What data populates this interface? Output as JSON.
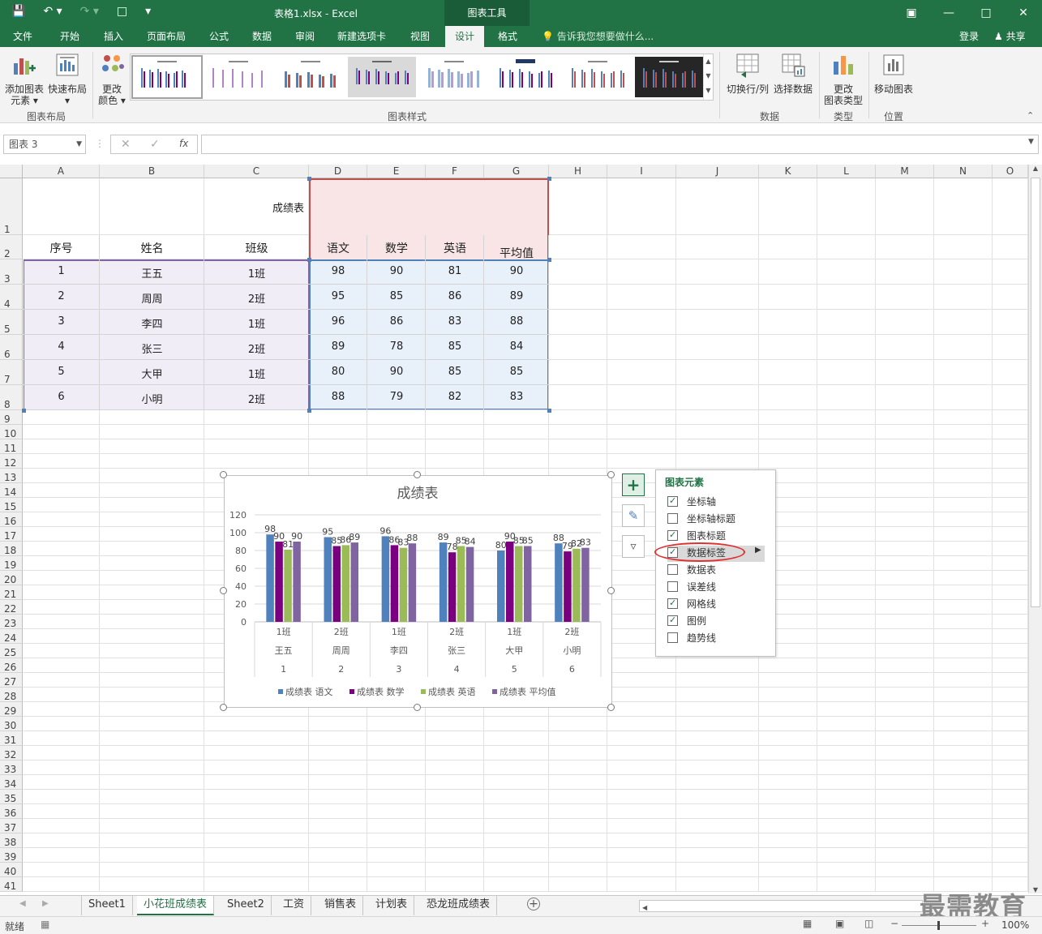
{
  "window": {
    "title": "表格1.xlsx - Excel",
    "context_tab": "图表工具"
  },
  "tabs": [
    "文件",
    "开始",
    "插入",
    "页面布局",
    "公式",
    "数据",
    "审阅",
    "新建选项卡",
    "视图",
    "设计",
    "格式"
  ],
  "active_tab": "设计",
  "tell_me": "告诉我您想要做什么...",
  "account": {
    "login": "登录",
    "share": "共享"
  },
  "ribbon": {
    "add_element": "添加图表\n元素",
    "add_element_l1": "添加图表",
    "add_element_l2": "元素",
    "quick_layout": "快速布局",
    "change_colors_l1": "更改",
    "change_colors_l2": "颜色",
    "group_layout": "图表布局",
    "group_styles": "图表样式",
    "switch_row_col": "切换行/列",
    "select_data": "选择数据",
    "group_data": "数据",
    "change_type_l1": "更改",
    "change_type_l2": "图表类型",
    "group_type": "类型",
    "move_chart": "移动图表",
    "group_location": "位置"
  },
  "formula_bar": {
    "name_box": "图表 3",
    "fx": "fx",
    "value": ""
  },
  "columns": [
    "A",
    "B",
    "C",
    "D",
    "E",
    "F",
    "G",
    "H",
    "I",
    "J",
    "K",
    "L",
    "M",
    "N",
    "O"
  ],
  "rows": [
    "1",
    "2",
    "3",
    "4",
    "5",
    "6",
    "7",
    "8",
    "9",
    "10",
    "11",
    "12",
    "13",
    "14",
    "15",
    "16",
    "17",
    "18",
    "19",
    "20",
    "21",
    "22",
    "23",
    "24",
    "25",
    "26",
    "27",
    "28",
    "29",
    "30",
    "31",
    "32",
    "33",
    "34",
    "35",
    "36",
    "37",
    "38",
    "39",
    "40",
    "41"
  ],
  "table": {
    "title": "成绩表",
    "headers": [
      "序号",
      "姓名",
      "班级",
      "语文",
      "数学",
      "英语",
      "平均值"
    ],
    "rows": [
      [
        "1",
        "王五",
        "1班",
        "98",
        "90",
        "81",
        "90"
      ],
      [
        "2",
        "周周",
        "2班",
        "95",
        "85",
        "86",
        "89"
      ],
      [
        "3",
        "李四",
        "1班",
        "96",
        "86",
        "83",
        "88"
      ],
      [
        "4",
        "张三",
        "2班",
        "89",
        "78",
        "85",
        "84"
      ],
      [
        "5",
        "大甲",
        "1班",
        "80",
        "90",
        "85",
        "85"
      ],
      [
        "6",
        "小明",
        "2班",
        "88",
        "79",
        "82",
        "83"
      ]
    ]
  },
  "chart_data": {
    "type": "bar",
    "title": "成绩表",
    "categories_level1": [
      "1班",
      "2班",
      "1班",
      "2班",
      "1班",
      "2班"
    ],
    "categories_level2": [
      "王五",
      "周周",
      "李四",
      "张三",
      "大甲",
      "小明"
    ],
    "categories_level3": [
      "1",
      "2",
      "3",
      "4",
      "5",
      "6"
    ],
    "series": [
      {
        "name": "成绩表 语文",
        "values": [
          98,
          95,
          96,
          89,
          80,
          88
        ],
        "color": "#4f81bd"
      },
      {
        "name": "成绩表 数学",
        "values": [
          90,
          85,
          86,
          78,
          90,
          79
        ],
        "color": "#7a0080"
      },
      {
        "name": "成绩表 英语",
        "values": [
          81,
          86,
          83,
          85,
          85,
          82
        ],
        "color": "#9bbb59"
      },
      {
        "name": "成绩表 平均值",
        "values": [
          90,
          89,
          88,
          84,
          85,
          83
        ],
        "color": "#8064a2"
      }
    ],
    "ylim": [
      0,
      120
    ],
    "yticks": [
      "0",
      "20",
      "40",
      "60",
      "80",
      "100",
      "120"
    ],
    "grid": true,
    "legend": "bottom",
    "data_labels": true
  },
  "chart_elements": {
    "header": "图表元素",
    "items": [
      {
        "label": "坐标轴",
        "checked": true
      },
      {
        "label": "坐标轴标题",
        "checked": false
      },
      {
        "label": "图表标题",
        "checked": true
      },
      {
        "label": "数据标签",
        "checked": true
      },
      {
        "label": "数据表",
        "checked": false
      },
      {
        "label": "误差线",
        "checked": false
      },
      {
        "label": "网格线",
        "checked": true
      },
      {
        "label": "图例",
        "checked": true
      },
      {
        "label": "趋势线",
        "checked": false
      }
    ]
  },
  "sheets": [
    "Sheet1",
    "小花班成绩表",
    "Sheet2",
    "工资",
    "销售表",
    "计划表",
    "恐龙班成绩表"
  ],
  "active_sheet": "小花班成绩表",
  "status": {
    "ready": "就绪",
    "zoom": "100%"
  },
  "watermark": "最需教育",
  "colors": {
    "excel_green": "#217346"
  }
}
